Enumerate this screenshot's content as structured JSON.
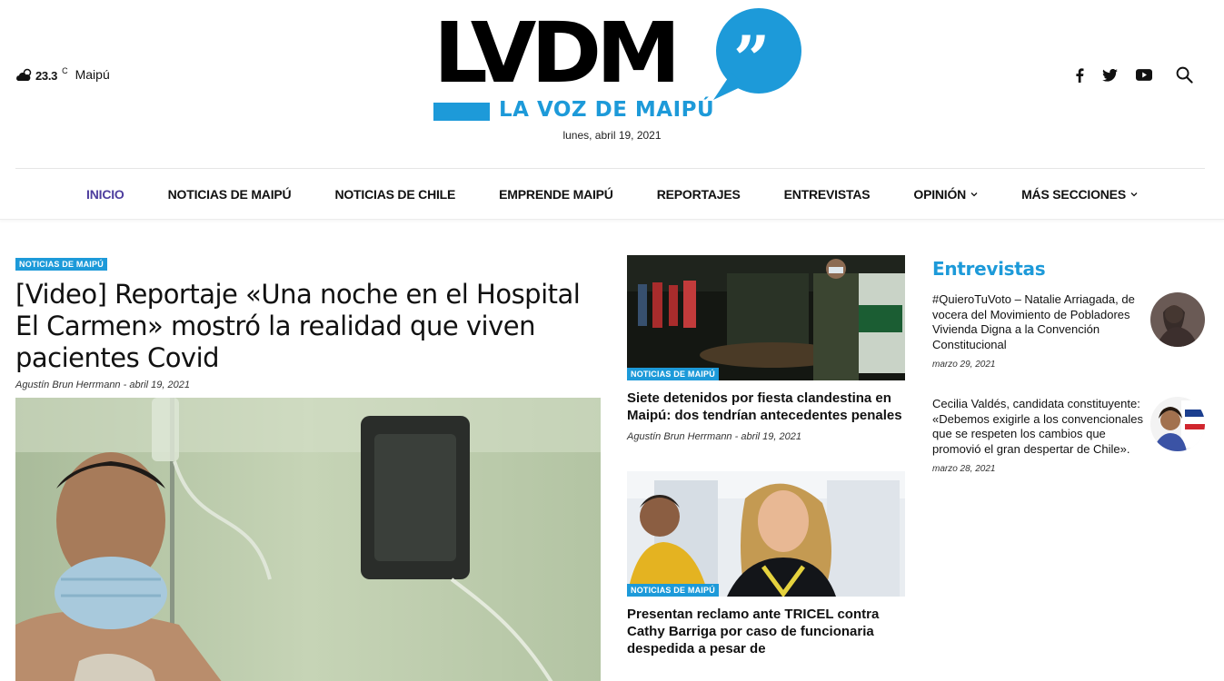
{
  "weather": {
    "temp": "23.3",
    "unit": "C",
    "location": "Maipú",
    "icon": "partly-cloudy-icon"
  },
  "logo": {
    "wordmark": "LVDM",
    "tagline": "LA VOZ DE MAIPÚ",
    "quote_mark": "”"
  },
  "header": {
    "date": "lunes, abril 19, 2021"
  },
  "social": [
    "facebook-icon",
    "twitter-icon",
    "youtube-icon",
    "search-icon"
  ],
  "nav": {
    "items": [
      {
        "label": "INICIO",
        "active": true
      },
      {
        "label": "NOTICIAS DE MAIPÚ"
      },
      {
        "label": "NOTICIAS DE CHILE"
      },
      {
        "label": "EMPRENDE MAIPÚ"
      },
      {
        "label": "REPORTAJES"
      },
      {
        "label": "ENTREVISTAS"
      },
      {
        "label": "OPINIÓN",
        "dropdown": true
      },
      {
        "label": "MÁS SECCIONES",
        "dropdown": true
      }
    ]
  },
  "main_article": {
    "category": "NOTICIAS DE MAIPÚ",
    "title": "[Video] Reportaje «Una noche en el Hospital El Carmen» mostró la realidad que viven pacientes Covid",
    "author": "Agustín Brun Herrmann",
    "date": "- abril 19, 2021"
  },
  "mid_articles": [
    {
      "category": "NOTICIAS DE MAIPÚ",
      "title": "Siete detenidos por fiesta clandestina en Maipú: dos tendrían antecedentes penales",
      "author": "Agustín Brun Herrmann",
      "date": "- abril 19, 2021"
    },
    {
      "category": "NOTICIAS DE MAIPÚ",
      "title": "Presentan reclamo ante TRICEL contra Cathy Barriga por caso de funcionaria despedida a pesar de"
    }
  ],
  "sidebar": {
    "heading": "Entrevistas",
    "items": [
      {
        "title": "#QuieroTuVoto – Natalie Arriagada, de vocera del Movimiento de Pobladores Vivienda Digna a la Convención Constitucional",
        "date": "marzo 29, 2021"
      },
      {
        "title": "Cecilia Valdés, candidata constituyente: «Debemos exigirle a los convencionales que se respeten los cambios que promovió el gran despertar de Chile».",
        "date": "marzo 28, 2021"
      }
    ]
  },
  "colors": {
    "accent": "#1d9ad9",
    "nav_active": "#4d3d9e"
  }
}
